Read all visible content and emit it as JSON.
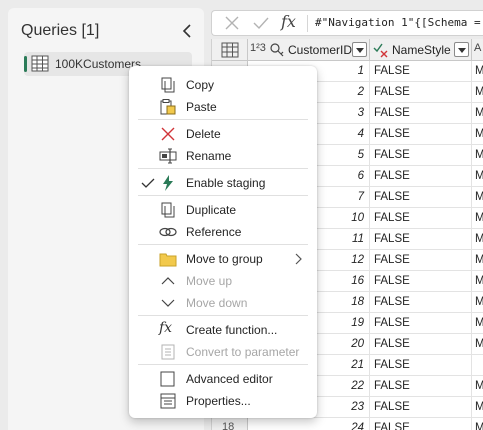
{
  "queries": {
    "title": "Queries [1]",
    "items": [
      {
        "label": "100KCustomers",
        "selected": true
      }
    ]
  },
  "formula_bar": {
    "formula": "#\"Navigation 1\"{[Schema ="
  },
  "grid": {
    "columns": [
      {
        "type_glyph": "1²3",
        "name": "CustomerID"
      },
      {
        "name": "NameStyle"
      },
      {
        "type_glyph": "A",
        "name": ""
      }
    ],
    "rows": [
      {
        "id": "1",
        "style": "FALSE",
        "c3": "M"
      },
      {
        "id": "2",
        "style": "FALSE",
        "c3": "M"
      },
      {
        "id": "3",
        "style": "FALSE",
        "c3": "M"
      },
      {
        "id": "4",
        "style": "FALSE",
        "c3": "M"
      },
      {
        "id": "5",
        "style": "FALSE",
        "c3": "M"
      },
      {
        "id": "6",
        "style": "FALSE",
        "c3": "M"
      },
      {
        "id": "7",
        "style": "FALSE",
        "c3": "M"
      },
      {
        "id": "10",
        "style": "FALSE",
        "c3": "M"
      },
      {
        "id": "11",
        "style": "FALSE",
        "c3": "M"
      },
      {
        "id": "12",
        "style": "FALSE",
        "c3": "M"
      },
      {
        "id": "16",
        "style": "FALSE",
        "c3": "M"
      },
      {
        "id": "18",
        "style": "FALSE",
        "c3": "M"
      },
      {
        "id": "19",
        "style": "FALSE",
        "c3": "M"
      },
      {
        "id": "20",
        "style": "FALSE",
        "c3": "M"
      },
      {
        "id": "21",
        "style": "FALSE",
        "c3": ""
      },
      {
        "id": "22",
        "style": "FALSE",
        "c3": "M"
      },
      {
        "id": "23",
        "style": "FALSE",
        "c3": "M"
      },
      {
        "id": "24",
        "style": "FALSE",
        "c3": "M"
      }
    ],
    "partial_row_number": "18"
  },
  "context_menu": {
    "copy": "Copy",
    "paste": "Paste",
    "delete": "Delete",
    "rename": "Rename",
    "enable_staging": "Enable staging",
    "duplicate": "Duplicate",
    "reference": "Reference",
    "move_to_group": "Move to group",
    "move_up": "Move up",
    "move_down": "Move down",
    "create_function": "Create function...",
    "convert_to_parameter": "Convert to parameter",
    "advanced_editor": "Advanced editor",
    "properties": "Properties..."
  },
  "icons": {
    "fx_glyph": "fx",
    "delete_color": "#d13438",
    "staging_color": "#2b7b58",
    "folder_color": "#f2c94c"
  }
}
